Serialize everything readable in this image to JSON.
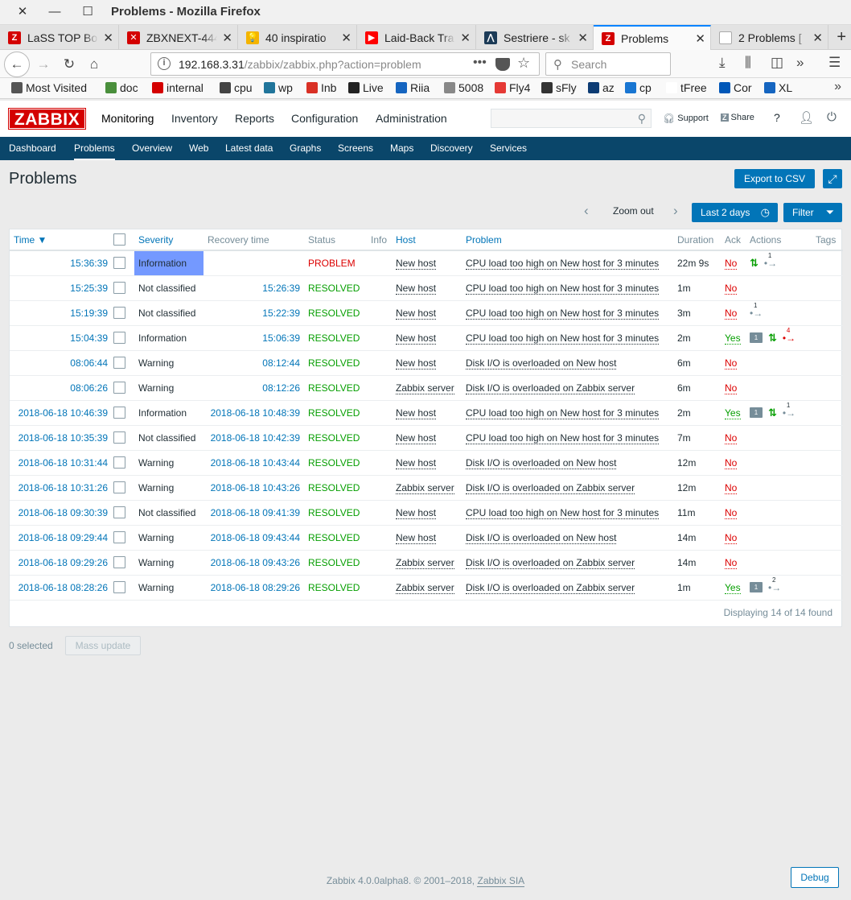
{
  "window": {
    "title": "Problems - Mozilla Firefox"
  },
  "tabs": [
    {
      "label": "LaSS TOP Bo",
      "fav_color": "#d40000",
      "fav_text": "Z"
    },
    {
      "label": "ZBXNEXT-444",
      "fav_color": "#d40000",
      "fav_text": "✕"
    },
    {
      "label": "40 inspiratio",
      "fav_color": "#f4b400",
      "fav_text": "💡"
    },
    {
      "label": "Laid-Back Tra",
      "fav_color": "#ff0000",
      "fav_text": "▶"
    },
    {
      "label": "Sestriere - sk",
      "fav_color": "#1c3b57",
      "fav_text": "⋀"
    },
    {
      "label": "Problems",
      "fav_color": "#d40000",
      "fav_text": "Z"
    },
    {
      "label": "2 Problems [",
      "fav_color": "#ffffff",
      "fav_text": ""
    }
  ],
  "url": {
    "host": "192.168.3.31",
    "path": "/zabbix/zabbix.php?action=problem"
  },
  "search": {
    "placeholder": "Search"
  },
  "bookmarks": [
    {
      "label": "Most Visited",
      "color": "#555555"
    },
    {
      "label": "doc",
      "color": "#4a8f3c"
    },
    {
      "label": "internal",
      "color": "#d40000"
    },
    {
      "label": "cpu",
      "color": "#444444"
    },
    {
      "label": "wp",
      "color": "#21759b"
    },
    {
      "label": "Inb",
      "color": "#d93025"
    },
    {
      "label": "Live",
      "color": "#222222"
    },
    {
      "label": "Riia",
      "color": "#1565c0"
    },
    {
      "label": "5008",
      "color": "#888888"
    },
    {
      "label": "Fly4",
      "color": "#e53935"
    },
    {
      "label": "sFly",
      "color": "#333333"
    },
    {
      "label": "az",
      "color": "#0d3c74"
    },
    {
      "label": "cp",
      "color": "#1976d2"
    },
    {
      "label": "tFree",
      "color": "#ffffff"
    },
    {
      "label": "Cor",
      "color": "#0057b8"
    },
    {
      "label": "XL",
      "color": "#1565c0"
    }
  ],
  "zabbix": {
    "logo": "ZABBIX",
    "menu": [
      "Monitoring",
      "Inventory",
      "Reports",
      "Configuration",
      "Administration"
    ],
    "support": "Support",
    "share": "Share",
    "help": "?",
    "submenu": [
      "Dashboard",
      "Problems",
      "Overview",
      "Web",
      "Latest data",
      "Graphs",
      "Screens",
      "Maps",
      "Discovery",
      "Services"
    ]
  },
  "page": {
    "title": "Problems",
    "export_label": "Export to CSV",
    "zoom_out": "Zoom out",
    "period": "Last 2 days",
    "filter": "Filter"
  },
  "columns": {
    "time": "Time ▼",
    "severity": "Severity",
    "recovery": "Recovery time",
    "status": "Status",
    "info": "Info",
    "host": "Host",
    "problem": "Problem",
    "duration": "Duration",
    "ack": "Ack",
    "actions": "Actions",
    "tags": "Tags"
  },
  "rows": [
    {
      "time": "15:36:39",
      "severity": "Information",
      "sev_highlight": true,
      "recovery": "",
      "status": "PROBLEM",
      "host": "New host",
      "problem": "CPU load too high on New host for 3 minutes",
      "duration": "22m 9s",
      "ack": "No",
      "actions": [
        "up",
        "esc:1"
      ]
    },
    {
      "time": "15:25:39",
      "severity": "Not classified",
      "recovery": "15:26:39",
      "status": "RESOLVED",
      "host": "New host",
      "problem": "CPU load too high on New host for 3 minutes",
      "duration": "1m",
      "ack": "No",
      "actions": []
    },
    {
      "time": "15:19:39",
      "severity": "Not classified",
      "recovery": "15:22:39",
      "status": "RESOLVED",
      "host": "New host",
      "problem": "CPU load too high on New host for 3 minutes",
      "duration": "3m",
      "ack": "No",
      "actions": [
        "esc:1"
      ]
    },
    {
      "time": "15:04:39",
      "severity": "Information",
      "recovery": "15:06:39",
      "status": "RESOLVED",
      "host": "New host",
      "problem": "CPU load too high on New host for 3 minutes",
      "duration": "2m",
      "ack": "Yes",
      "actions": [
        "msg:1",
        "up",
        "escred:4"
      ]
    },
    {
      "time": "08:06:44",
      "severity": "Warning",
      "recovery": "08:12:44",
      "status": "RESOLVED",
      "host": "New host",
      "problem": "Disk I/O is overloaded on New host",
      "duration": "6m",
      "ack": "No",
      "actions": []
    },
    {
      "time": "08:06:26",
      "severity": "Warning",
      "recovery": "08:12:26",
      "status": "RESOLVED",
      "host": "Zabbix server",
      "problem": "Disk I/O is overloaded on Zabbix server",
      "duration": "6m",
      "ack": "No",
      "actions": []
    },
    {
      "time": "2018-06-18 10:46:39",
      "severity": "Information",
      "recovery": "2018-06-18 10:48:39",
      "status": "RESOLVED",
      "host": "New host",
      "problem": "CPU load too high on New host for 3 minutes",
      "duration": "2m",
      "ack": "Yes",
      "actions": [
        "msg:1",
        "up",
        "esc:1"
      ]
    },
    {
      "time": "2018-06-18 10:35:39",
      "severity": "Not classified",
      "recovery": "2018-06-18 10:42:39",
      "status": "RESOLVED",
      "host": "New host",
      "problem": "CPU load too high on New host for 3 minutes",
      "duration": "7m",
      "ack": "No",
      "actions": []
    },
    {
      "time": "2018-06-18 10:31:44",
      "severity": "Warning",
      "recovery": "2018-06-18 10:43:44",
      "status": "RESOLVED",
      "host": "New host",
      "problem": "Disk I/O is overloaded on New host",
      "duration": "12m",
      "ack": "No",
      "actions": []
    },
    {
      "time": "2018-06-18 10:31:26",
      "severity": "Warning",
      "recovery": "2018-06-18 10:43:26",
      "status": "RESOLVED",
      "host": "Zabbix server",
      "problem": "Disk I/O is overloaded on Zabbix server",
      "duration": "12m",
      "ack": "No",
      "actions": []
    },
    {
      "time": "2018-06-18 09:30:39",
      "severity": "Not classified",
      "recovery": "2018-06-18 09:41:39",
      "status": "RESOLVED",
      "host": "New host",
      "problem": "CPU load too high on New host for 3 minutes",
      "duration": "11m",
      "ack": "No",
      "actions": []
    },
    {
      "time": "2018-06-18 09:29:44",
      "severity": "Warning",
      "recovery": "2018-06-18 09:43:44",
      "status": "RESOLVED",
      "host": "New host",
      "problem": "Disk I/O is overloaded on New host",
      "duration": "14m",
      "ack": "No",
      "actions": []
    },
    {
      "time": "2018-06-18 09:29:26",
      "severity": "Warning",
      "recovery": "2018-06-18 09:43:26",
      "status": "RESOLVED",
      "host": "Zabbix server",
      "problem": "Disk I/O is overloaded on Zabbix server",
      "duration": "14m",
      "ack": "No",
      "actions": []
    },
    {
      "time": "2018-06-18 08:28:26",
      "severity": "Warning",
      "recovery": "2018-06-18 08:29:26",
      "status": "RESOLVED",
      "host": "Zabbix server",
      "problem": "Disk I/O is overloaded on Zabbix server",
      "duration": "1m",
      "ack": "Yes",
      "actions": [
        "msg:1",
        "esc:2"
      ]
    }
  ],
  "table_footer": "Displaying 14 of 14 found",
  "selected": "0 selected",
  "mass_update": "Mass update",
  "footer": {
    "text": "Zabbix 4.0.0alpha8. © 2001–2018,",
    "link": "Zabbix SIA"
  },
  "debug": "Debug"
}
